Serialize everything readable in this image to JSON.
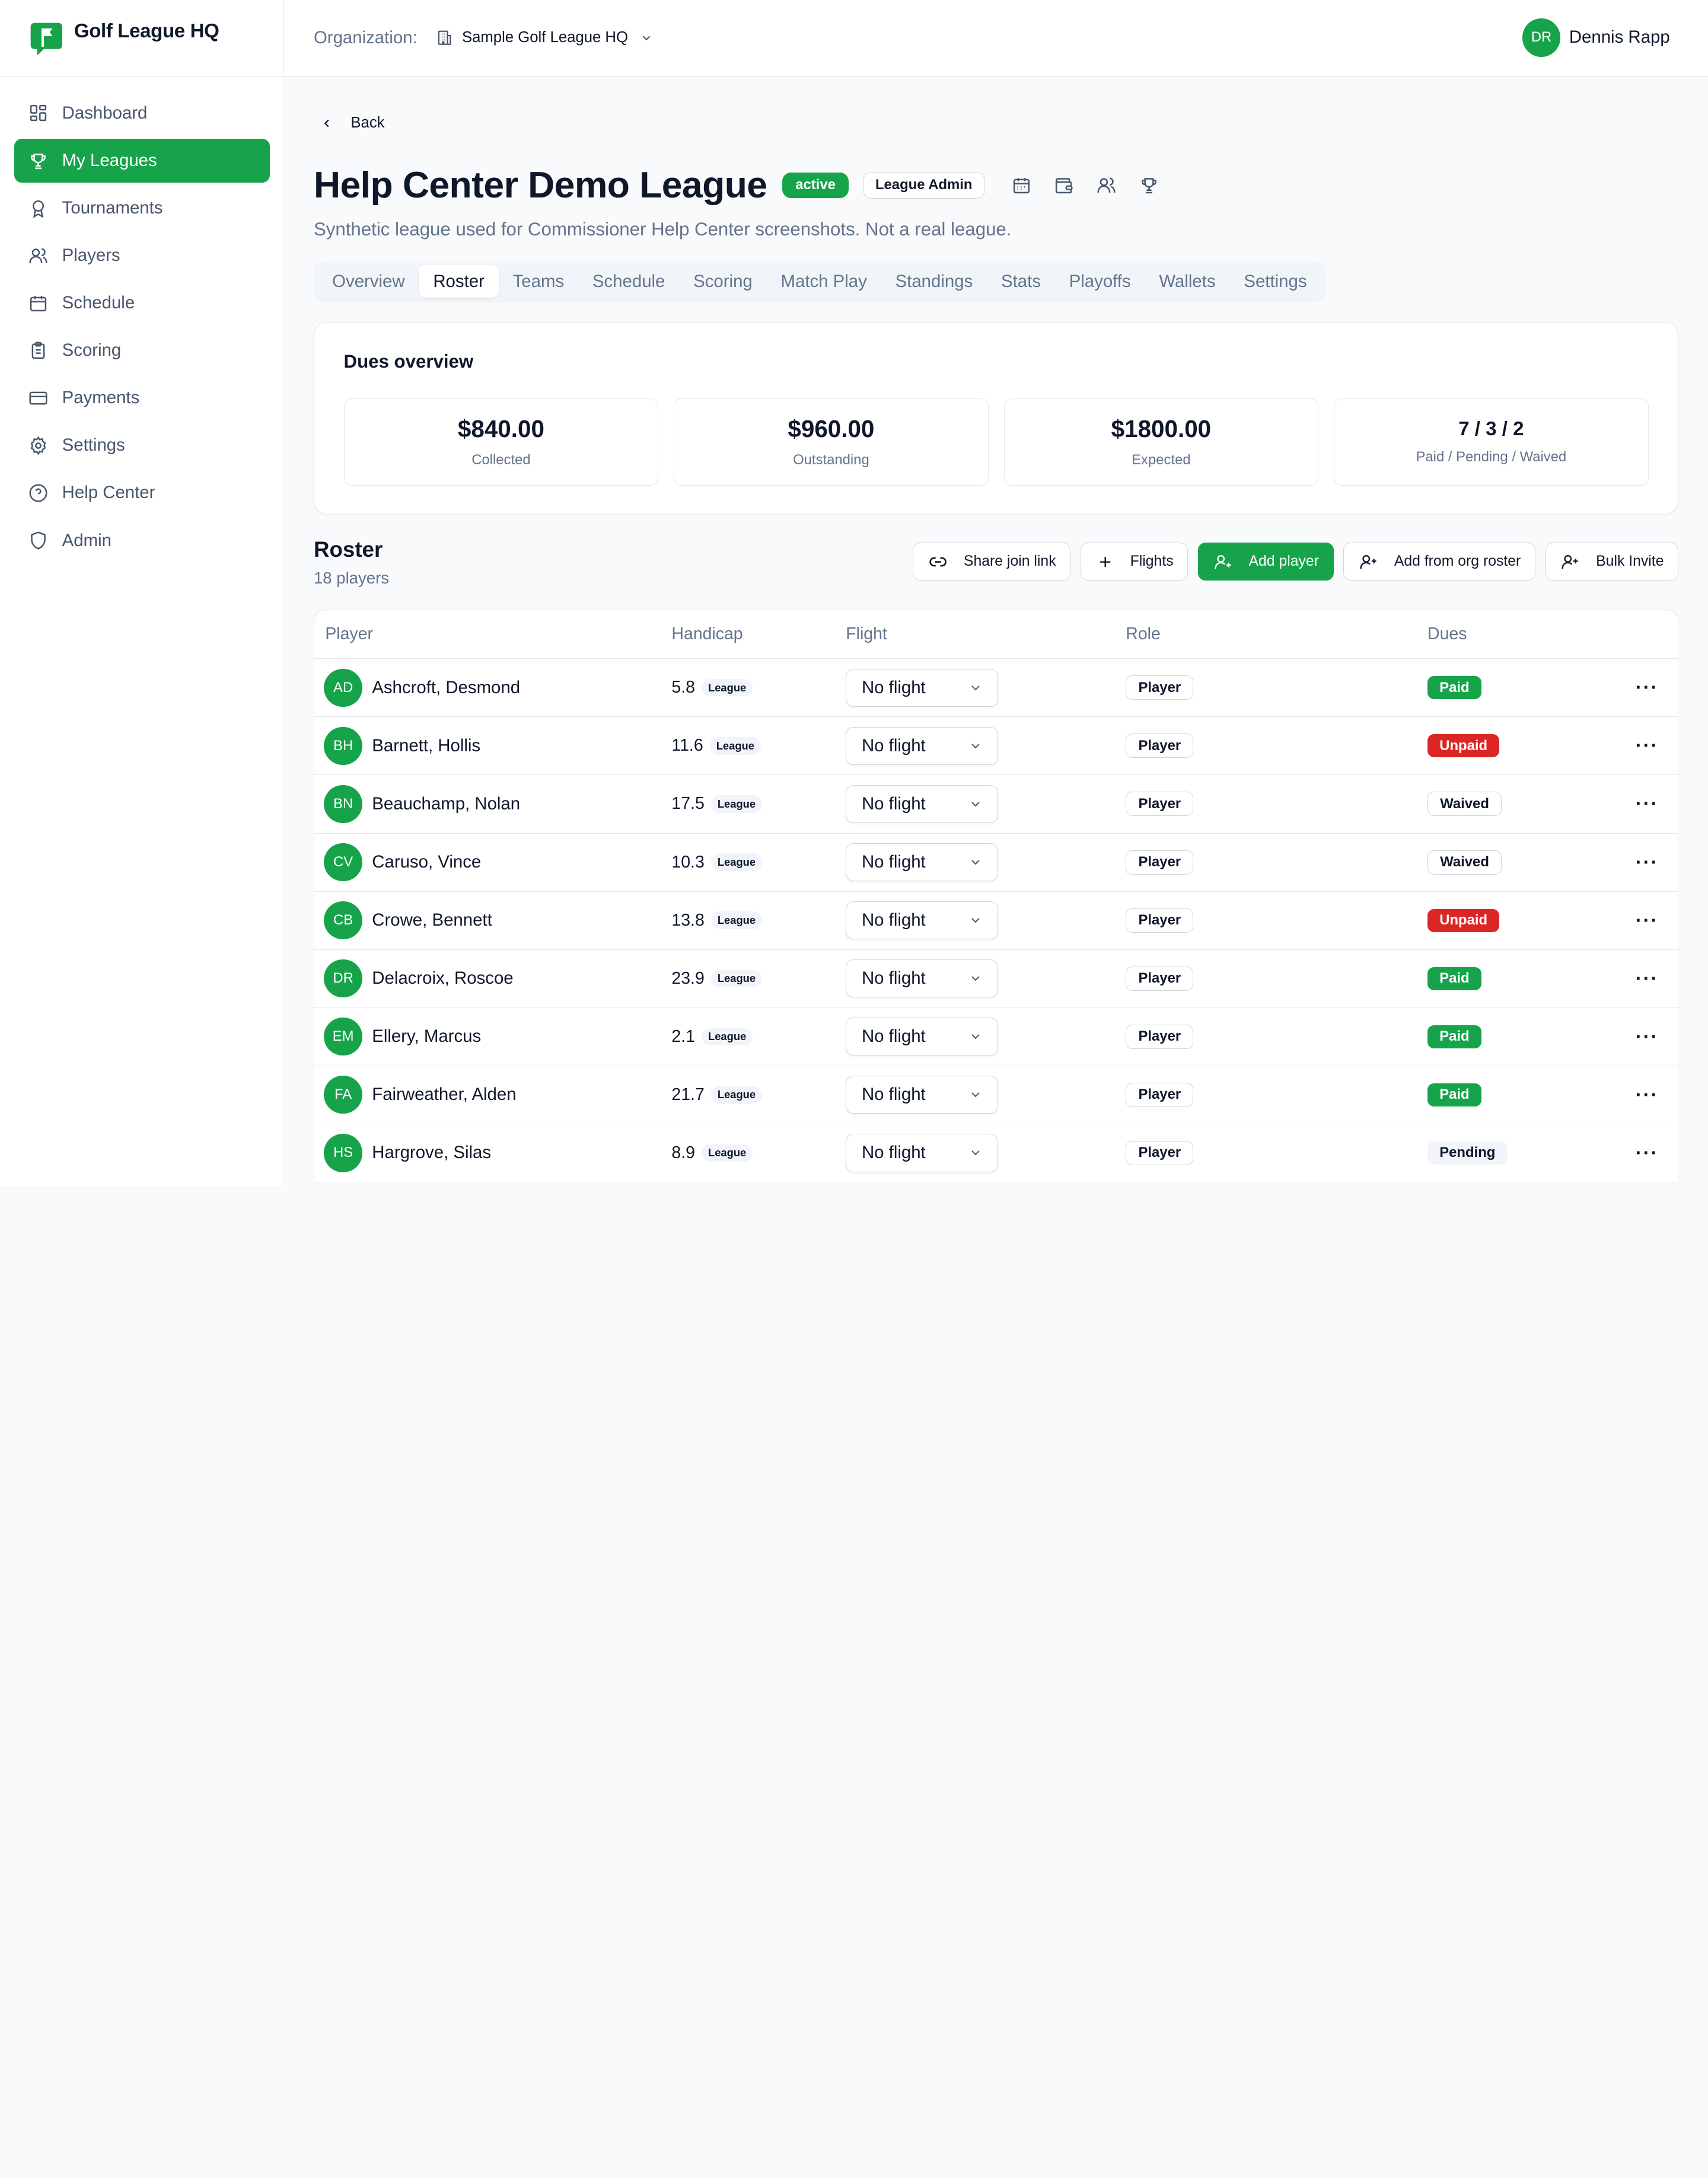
{
  "brand": {
    "name": "Golf League HQ",
    "logo_icon": "flag-icon",
    "color": "#16a34a"
  },
  "sidebar": {
    "items": [
      {
        "label": "Dashboard",
        "icon": "dashboard-icon",
        "active": false
      },
      {
        "label": "My Leagues",
        "icon": "trophy-icon",
        "active": true
      },
      {
        "label": "Tournaments",
        "icon": "award-icon",
        "active": false
      },
      {
        "label": "Players",
        "icon": "users-icon",
        "active": false
      },
      {
        "label": "Schedule",
        "icon": "calendar-icon",
        "active": false
      },
      {
        "label": "Scoring",
        "icon": "clipboard-icon",
        "active": false
      },
      {
        "label": "Payments",
        "icon": "credit-card-icon",
        "active": false
      },
      {
        "label": "Settings",
        "icon": "gear-icon",
        "active": false
      },
      {
        "label": "Help Center",
        "icon": "help-circle-icon",
        "active": false
      },
      {
        "label": "Admin",
        "icon": "shield-icon",
        "active": false
      }
    ]
  },
  "topbar": {
    "org_label": "Organization:",
    "org_name": "Sample Golf League HQ",
    "user_initials": "DR",
    "user_name": "Dennis Rapp"
  },
  "page": {
    "back_label": "Back",
    "title": "Help Center Demo League",
    "status_badge": "active",
    "role_badge": "League Admin",
    "subtitle": "Synthetic league used for Commissioner Help Center screenshots. Not a real league."
  },
  "tabs": [
    {
      "label": "Overview",
      "active": false
    },
    {
      "label": "Roster",
      "active": true
    },
    {
      "label": "Teams",
      "active": false
    },
    {
      "label": "Schedule",
      "active": false
    },
    {
      "label": "Scoring",
      "active": false
    },
    {
      "label": "Match Play",
      "active": false
    },
    {
      "label": "Standings",
      "active": false
    },
    {
      "label": "Stats",
      "active": false
    },
    {
      "label": "Playoffs",
      "active": false
    },
    {
      "label": "Wallets",
      "active": false
    },
    {
      "label": "Settings",
      "active": false
    }
  ],
  "dues": {
    "title": "Dues overview",
    "collected": {
      "value": "$840.00",
      "label": "Collected"
    },
    "outstanding": {
      "value": "$960.00",
      "label": "Outstanding"
    },
    "expected": {
      "value": "$1800.00",
      "label": "Expected"
    },
    "counts": {
      "value": "7 / 3 / 2",
      "label": "Paid / Pending / Waived"
    }
  },
  "roster": {
    "title": "Roster",
    "count": "18 players",
    "actions": {
      "share": "Share join link",
      "flights": "Flights",
      "add_player": "Add player",
      "add_from_org": "Add from org roster",
      "bulk_invite": "Bulk Invite"
    },
    "columns": {
      "player": "Player",
      "handicap": "Handicap",
      "flight": "Flight",
      "role": "Role",
      "dues": "Dues"
    },
    "rows": [
      {
        "initials": "AD",
        "name": "Ashcroft, Desmond",
        "handicap": "5.8",
        "hcp_tag": "League",
        "flight": "No flight",
        "role": "Player",
        "dues": "Paid",
        "dues_status": "paid"
      },
      {
        "initials": "BH",
        "name": "Barnett, Hollis",
        "handicap": "11.6",
        "hcp_tag": "League",
        "flight": "No flight",
        "role": "Player",
        "dues": "Unpaid",
        "dues_status": "unpaid"
      },
      {
        "initials": "BN",
        "name": "Beauchamp, Nolan",
        "handicap": "17.5",
        "hcp_tag": "League",
        "flight": "No flight",
        "role": "Player",
        "dues": "Waived",
        "dues_status": "waived"
      },
      {
        "initials": "CV",
        "name": "Caruso, Vince",
        "handicap": "10.3",
        "hcp_tag": "League",
        "flight": "No flight",
        "role": "Player",
        "dues": "Waived",
        "dues_status": "waived"
      },
      {
        "initials": "CB",
        "name": "Crowe, Bennett",
        "handicap": "13.8",
        "hcp_tag": "League",
        "flight": "No flight",
        "role": "Player",
        "dues": "Unpaid",
        "dues_status": "unpaid"
      },
      {
        "initials": "DR",
        "name": "Delacroix, Roscoe",
        "handicap": "23.9",
        "hcp_tag": "League",
        "flight": "No flight",
        "role": "Player",
        "dues": "Paid",
        "dues_status": "paid"
      },
      {
        "initials": "EM",
        "name": "Ellery, Marcus",
        "handicap": "2.1",
        "hcp_tag": "League",
        "flight": "No flight",
        "role": "Player",
        "dues": "Paid",
        "dues_status": "paid"
      },
      {
        "initials": "FA",
        "name": "Fairweather, Alden",
        "handicap": "21.7",
        "hcp_tag": "League",
        "flight": "No flight",
        "role": "Player",
        "dues": "Paid",
        "dues_status": "paid"
      },
      {
        "initials": "HS",
        "name": "Hargrove, Silas",
        "handicap": "8.9",
        "hcp_tag": "League",
        "flight": "No flight",
        "role": "Player",
        "dues": "Pending",
        "dues_status": "pending"
      }
    ]
  }
}
